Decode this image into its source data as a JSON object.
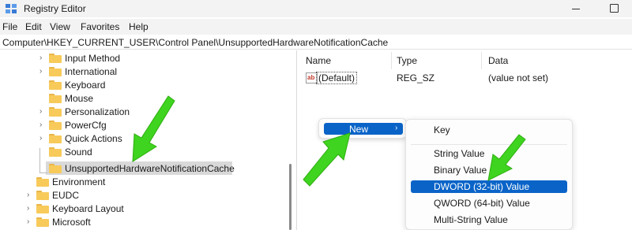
{
  "window": {
    "title": "Registry Editor"
  },
  "menubar": {
    "items": [
      "File",
      "Edit",
      "View",
      "Favorites",
      "Help"
    ]
  },
  "address": {
    "path": "Computer\\HKEY_CURRENT_USER\\Control Panel\\UnsupportedHardwareNotificationCache"
  },
  "tree": {
    "items": [
      {
        "label": "Input Method",
        "expandable": true
      },
      {
        "label": "International",
        "expandable": true
      },
      {
        "label": "Keyboard",
        "expandable": false
      },
      {
        "label": "Mouse",
        "expandable": false
      },
      {
        "label": "Personalization",
        "expandable": true
      },
      {
        "label": "PowerCfg",
        "expandable": true
      },
      {
        "label": "Quick Actions",
        "expandable": true
      },
      {
        "label": "Sound",
        "expandable": false
      },
      {
        "label": "UnsupportedHardwareNotificationCache",
        "expandable": false,
        "selected": true
      },
      {
        "label": "Environment",
        "expandable": false
      },
      {
        "label": "EUDC",
        "expandable": true
      },
      {
        "label": "Keyboard Layout",
        "expandable": true
      },
      {
        "label": "Microsoft",
        "expandable": true
      }
    ]
  },
  "values_pane": {
    "columns": [
      "Name",
      "Type",
      "Data"
    ],
    "rows": [
      {
        "icon": "ab",
        "name": "(Default)",
        "type": "REG_SZ",
        "data": "(value not set)"
      }
    ]
  },
  "context_menu": {
    "new_label": "New"
  },
  "submenu": {
    "items": [
      {
        "label": "Key",
        "selected": false
      },
      {
        "label": "String Value",
        "selected": false
      },
      {
        "label": "Binary Value",
        "selected": false
      },
      {
        "label": "DWORD (32-bit) Value",
        "selected": true
      },
      {
        "label": "QWORD (64-bit) Value",
        "selected": false
      },
      {
        "label": "Multi-String Value",
        "selected": false
      }
    ]
  },
  "colors": {
    "accent": "#0a64c8",
    "arrow": "#3fd41f",
    "folder": "#f7ca5a",
    "selection_gray": "#d9d9d9"
  }
}
